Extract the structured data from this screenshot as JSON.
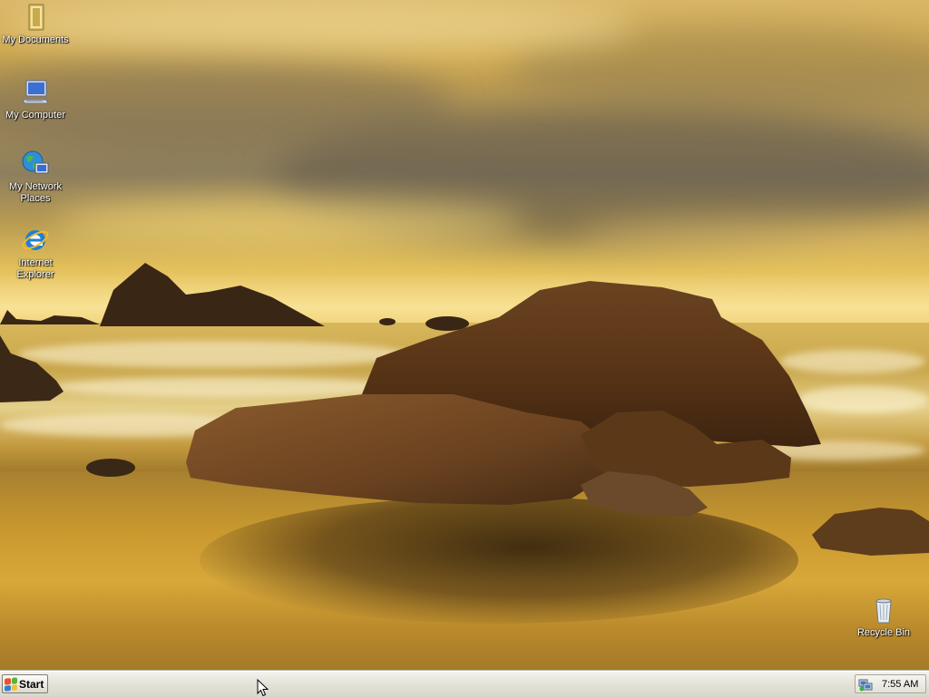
{
  "desktop": {
    "icons": [
      {
        "label": "My Documents",
        "icon": "folder-documents-icon"
      },
      {
        "label": "My Computer",
        "icon": "computer-icon"
      },
      {
        "label": "My Network Places",
        "icon": "network-places-icon"
      },
      {
        "label": "Internet Explorer",
        "icon": "internet-explorer-icon"
      },
      {
        "label": "Recycle Bin",
        "icon": "recycle-bin-icon"
      }
    ]
  },
  "taskbar": {
    "start_label": "Start",
    "clock": "7:55 AM",
    "tray_icon": "network-status-icon"
  },
  "colors": {
    "taskbar": "#e6e4db",
    "label_text": "#ffffff"
  }
}
